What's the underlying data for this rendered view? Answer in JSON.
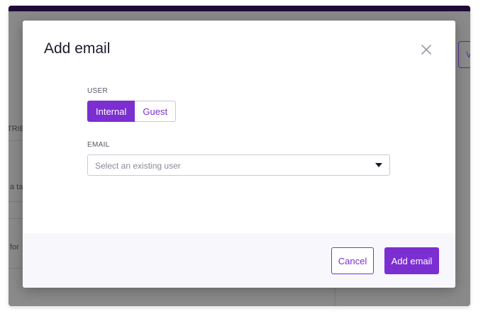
{
  "background": {
    "column_header_fragment": "TRIB",
    "row_text_1": "a ta",
    "row_text_2": "for",
    "button_fragment": "V"
  },
  "modal": {
    "title": "Add email",
    "close_icon": "close-icon",
    "user_label": "USER",
    "user_options": [
      "Internal",
      "Guest"
    ],
    "user_selected": "Internal",
    "email_label": "EMAIL",
    "email_placeholder": "Select an existing user",
    "cancel_label": "Cancel",
    "submit_label": "Add email"
  },
  "colors": {
    "accent": "#7b2fd1",
    "overlay": "#8a8a8a",
    "topbar": "#1d0b38",
    "footer_bg": "#f8f7fb"
  }
}
